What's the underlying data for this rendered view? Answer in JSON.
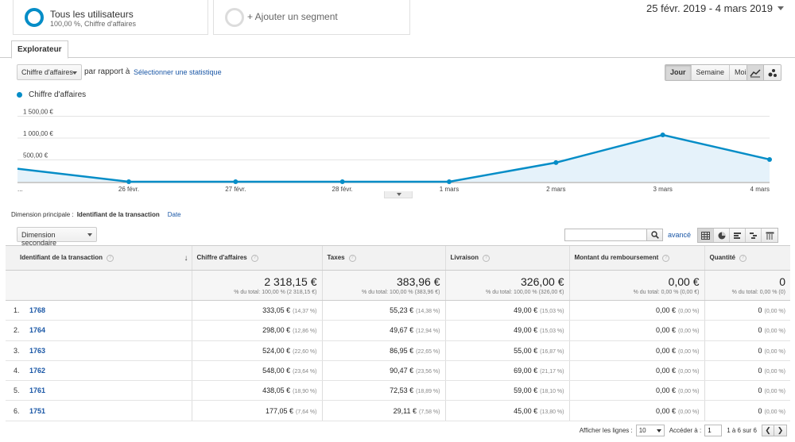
{
  "segments": {
    "active": {
      "title": "Tous les utilisateurs",
      "subtitle": "100,00 %, Chiffre d'affaires"
    },
    "add_label": "+ Ajouter un segment"
  },
  "date_range": "25 févr. 2019 - 4 mars 2019",
  "tab": {
    "label": "Explorateur"
  },
  "controls": {
    "metric": "Chiffre d'affaires",
    "vs_label": "par rapport à",
    "select_stat": "Sélectionner une statistique",
    "periods": [
      "Jour",
      "Semaine",
      "Mois"
    ],
    "active_period": "Jour"
  },
  "legend": {
    "label": "Chiffre d'affaires",
    "color": "#058dc7"
  },
  "chart_data": {
    "type": "area",
    "series": [
      {
        "name": "Chiffre d'affaires",
        "values": [
          298.0,
          0,
          0,
          0,
          0,
          438.05,
          1072.0,
          510.1
        ]
      }
    ],
    "x": [
      "...",
      "26 févr.",
      "27 févr.",
      "28 févr.",
      "1 mars",
      "2 mars",
      "3 mars",
      "4 mars"
    ],
    "y_ticks": [
      "500,00 €",
      "1 000,00 €",
      "1 500,00 €"
    ],
    "y_tick_values": [
      500,
      1000,
      1500
    ],
    "ylim": [
      0,
      1800
    ],
    "color": "#058dc7",
    "grid": true
  },
  "dimension": {
    "label": "Dimension principale :",
    "active": "Identifiant de la transaction",
    "other": "Date"
  },
  "secondary_dimension": "Dimension secondaire",
  "search": {
    "advanced": "avancé"
  },
  "table": {
    "columns": [
      "Identifiant de la transaction",
      "Chiffre d'affaires",
      "Taxes",
      "Livraison",
      "Montant du remboursement",
      "Quantité"
    ],
    "totals": [
      {
        "value": "2 318,15 €",
        "sub": "% du total: 100,00 % (2 318,15 €)"
      },
      {
        "value": "383,96 €",
        "sub": "% du total: 100,00 % (383,96 €)"
      },
      {
        "value": "326,00 €",
        "sub": "% du total: 100,00 % (326,00 €)"
      },
      {
        "value": "0,00 €",
        "sub": "% du total: 0,00 % (0,00 €)"
      },
      {
        "value": "0",
        "sub": "% du total: 0,00 % (0)"
      }
    ],
    "rows": [
      {
        "num": "1.",
        "id": "1768",
        "cells": [
          [
            "333,05 €",
            "(14,37 %)"
          ],
          [
            "55,23 €",
            "(14,38 %)"
          ],
          [
            "49,00 €",
            "(15,03 %)"
          ],
          [
            "0,00 €",
            "(0,00 %)"
          ],
          [
            "0",
            "(0,00 %)"
          ]
        ]
      },
      {
        "num": "2.",
        "id": "1764",
        "cells": [
          [
            "298,00 €",
            "(12,86 %)"
          ],
          [
            "49,67 €",
            "(12,94 %)"
          ],
          [
            "49,00 €",
            "(15,03 %)"
          ],
          [
            "0,00 €",
            "(0,00 %)"
          ],
          [
            "0",
            "(0,00 %)"
          ]
        ]
      },
      {
        "num": "3.",
        "id": "1763",
        "cells": [
          [
            "524,00 €",
            "(22,60 %)"
          ],
          [
            "86,95 €",
            "(22,65 %)"
          ],
          [
            "55,00 €",
            "(16,87 %)"
          ],
          [
            "0,00 €",
            "(0,00 %)"
          ],
          [
            "0",
            "(0,00 %)"
          ]
        ]
      },
      {
        "num": "4.",
        "id": "1762",
        "cells": [
          [
            "548,00 €",
            "(23,64 %)"
          ],
          [
            "90,47 €",
            "(23,56 %)"
          ],
          [
            "69,00 €",
            "(21,17 %)"
          ],
          [
            "0,00 €",
            "(0,00 %)"
          ],
          [
            "0",
            "(0,00 %)"
          ]
        ]
      },
      {
        "num": "5.",
        "id": "1761",
        "cells": [
          [
            "438,05 €",
            "(18,90 %)"
          ],
          [
            "72,53 €",
            "(18,89 %)"
          ],
          [
            "59,00 €",
            "(18,10 %)"
          ],
          [
            "0,00 €",
            "(0,00 %)"
          ],
          [
            "0",
            "(0,00 %)"
          ]
        ]
      },
      {
        "num": "6.",
        "id": "1751",
        "cells": [
          [
            "177,05 €",
            "(7,64 %)"
          ],
          [
            "29,11 €",
            "(7,58 %)"
          ],
          [
            "45,00 €",
            "(13,80 %)"
          ],
          [
            "0,00 €",
            "(0,00 %)"
          ],
          [
            "0",
            "(0,00 %)"
          ]
        ]
      }
    ]
  },
  "pagination": {
    "rows_label": "Afficher les lignes :",
    "rows_value": "10",
    "goto_label": "Accéder à :",
    "goto_value": "1",
    "range": "1 à 6 sur 6"
  }
}
